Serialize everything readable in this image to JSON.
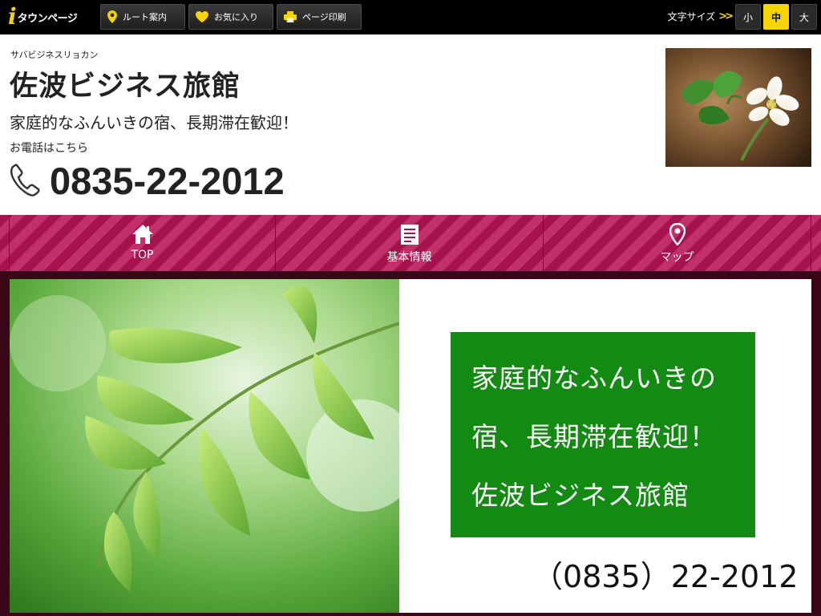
{
  "topbar": {
    "logo_mark": "i",
    "logo_text": "タウンページ",
    "buttons": [
      {
        "label": "ルート案内",
        "icon": "map-pin-icon"
      },
      {
        "label": "お気に入り",
        "icon": "heart-icon"
      },
      {
        "label": "ページ印刷",
        "icon": "printer-icon"
      }
    ],
    "font_size_label": "文字サイズ",
    "font_sizes": [
      "小",
      "中",
      "大"
    ],
    "font_size_selected": "中",
    "accent_color": "#f5d400"
  },
  "header": {
    "kana": "サバビジネスリョカン",
    "title": "佐波ビジネス旅館",
    "catchphrase": "家庭的なふんいきの宿、長期滞在歓迎！",
    "tel_label": "お電話はこちら",
    "phone": "0835-22-2012",
    "photo": "white-flower-photo"
  },
  "nav": {
    "items": [
      {
        "label": "TOP",
        "icon": "home-icon"
      },
      {
        "label": "基本情報",
        "icon": "document-icon"
      },
      {
        "label": "マップ",
        "icon": "map-pin-icon"
      }
    ],
    "colors": [
      "#a5124e",
      "#c13069"
    ]
  },
  "hero": {
    "photo": "green-leaves-photo",
    "box_lines": [
      "家庭的なふんいきの",
      "宿、長期滞在歓迎！",
      "佐波ビジネス旅館"
    ],
    "phone": "（0835）22-2012",
    "box_color": "#138a12"
  }
}
